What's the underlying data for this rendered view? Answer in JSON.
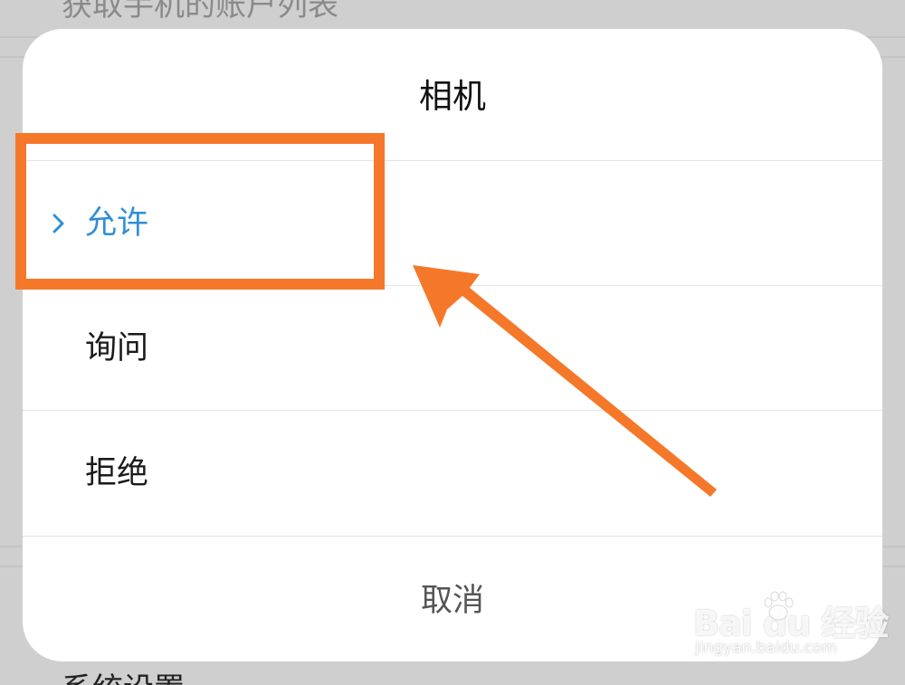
{
  "background": {
    "top_text": "获取手机的账户列表",
    "bottom_text": "系统设置"
  },
  "dialog": {
    "title": "相机",
    "options": [
      {
        "label": "允许",
        "selected": true
      },
      {
        "label": "询问",
        "selected": false
      },
      {
        "label": "拒绝",
        "selected": false
      }
    ],
    "cancel_label": "取消"
  },
  "colors": {
    "selected_text": "#2e8fd6",
    "annotation": "#f5782a",
    "overlay": "#cfcfcf"
  },
  "icons": {
    "selected_marker": "chevron-right-icon"
  },
  "watermark": {
    "logo": "Bai  du 经验",
    "url": "jingyan.baidu.com"
  }
}
